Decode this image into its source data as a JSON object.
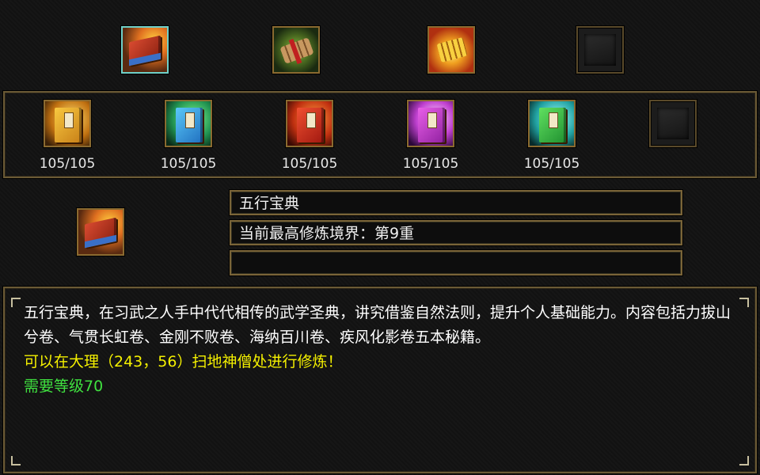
{
  "top_row": {
    "icons": [
      {
        "icon": "wuxing-book-icon",
        "selected": true
      },
      {
        "icon": "scroll-bundle-icon",
        "selected": false
      },
      {
        "icon": "golden-scroll-icon",
        "selected": false
      },
      {
        "icon": "empty-slot-icon",
        "selected": false
      }
    ]
  },
  "volumes_row": {
    "items": [
      {
        "icon": "yellow-book-icon",
        "color": "#e8b030",
        "count": "105/105"
      },
      {
        "icon": "blue-book-icon",
        "color": "#3aa8e0",
        "count": "105/105"
      },
      {
        "icon": "red-book-icon",
        "color": "#d83a20",
        "count": "105/105"
      },
      {
        "icon": "purple-book-icon",
        "color": "#c030c0",
        "count": "105/105"
      },
      {
        "icon": "green-book-icon",
        "color": "#30c040",
        "count": "105/105"
      },
      {
        "icon": "empty-slot-icon",
        "color": "#1c1c1c",
        "count": ""
      }
    ]
  },
  "detail": {
    "name": "五行宝典",
    "realm": "当前最高修炼境界：第9重",
    "extra": ""
  },
  "description": {
    "text": "五行宝典，在习武之人手中代代相传的武学圣典，讲究借鉴自然法则，提升个人基础能力。内容包括力拔山兮卷、气贯长虹卷、金刚不败卷、海纳百川卷、疾风化影卷五本秘籍。",
    "location": "可以在大理（243，56）扫地神僧处进行修炼！",
    "requirement": "需要等级70"
  },
  "colors": {
    "frame": "#6b5a35",
    "text_white": "#ffffff",
    "text_yellow": "#f4f000",
    "text_green": "#3fe03f"
  }
}
